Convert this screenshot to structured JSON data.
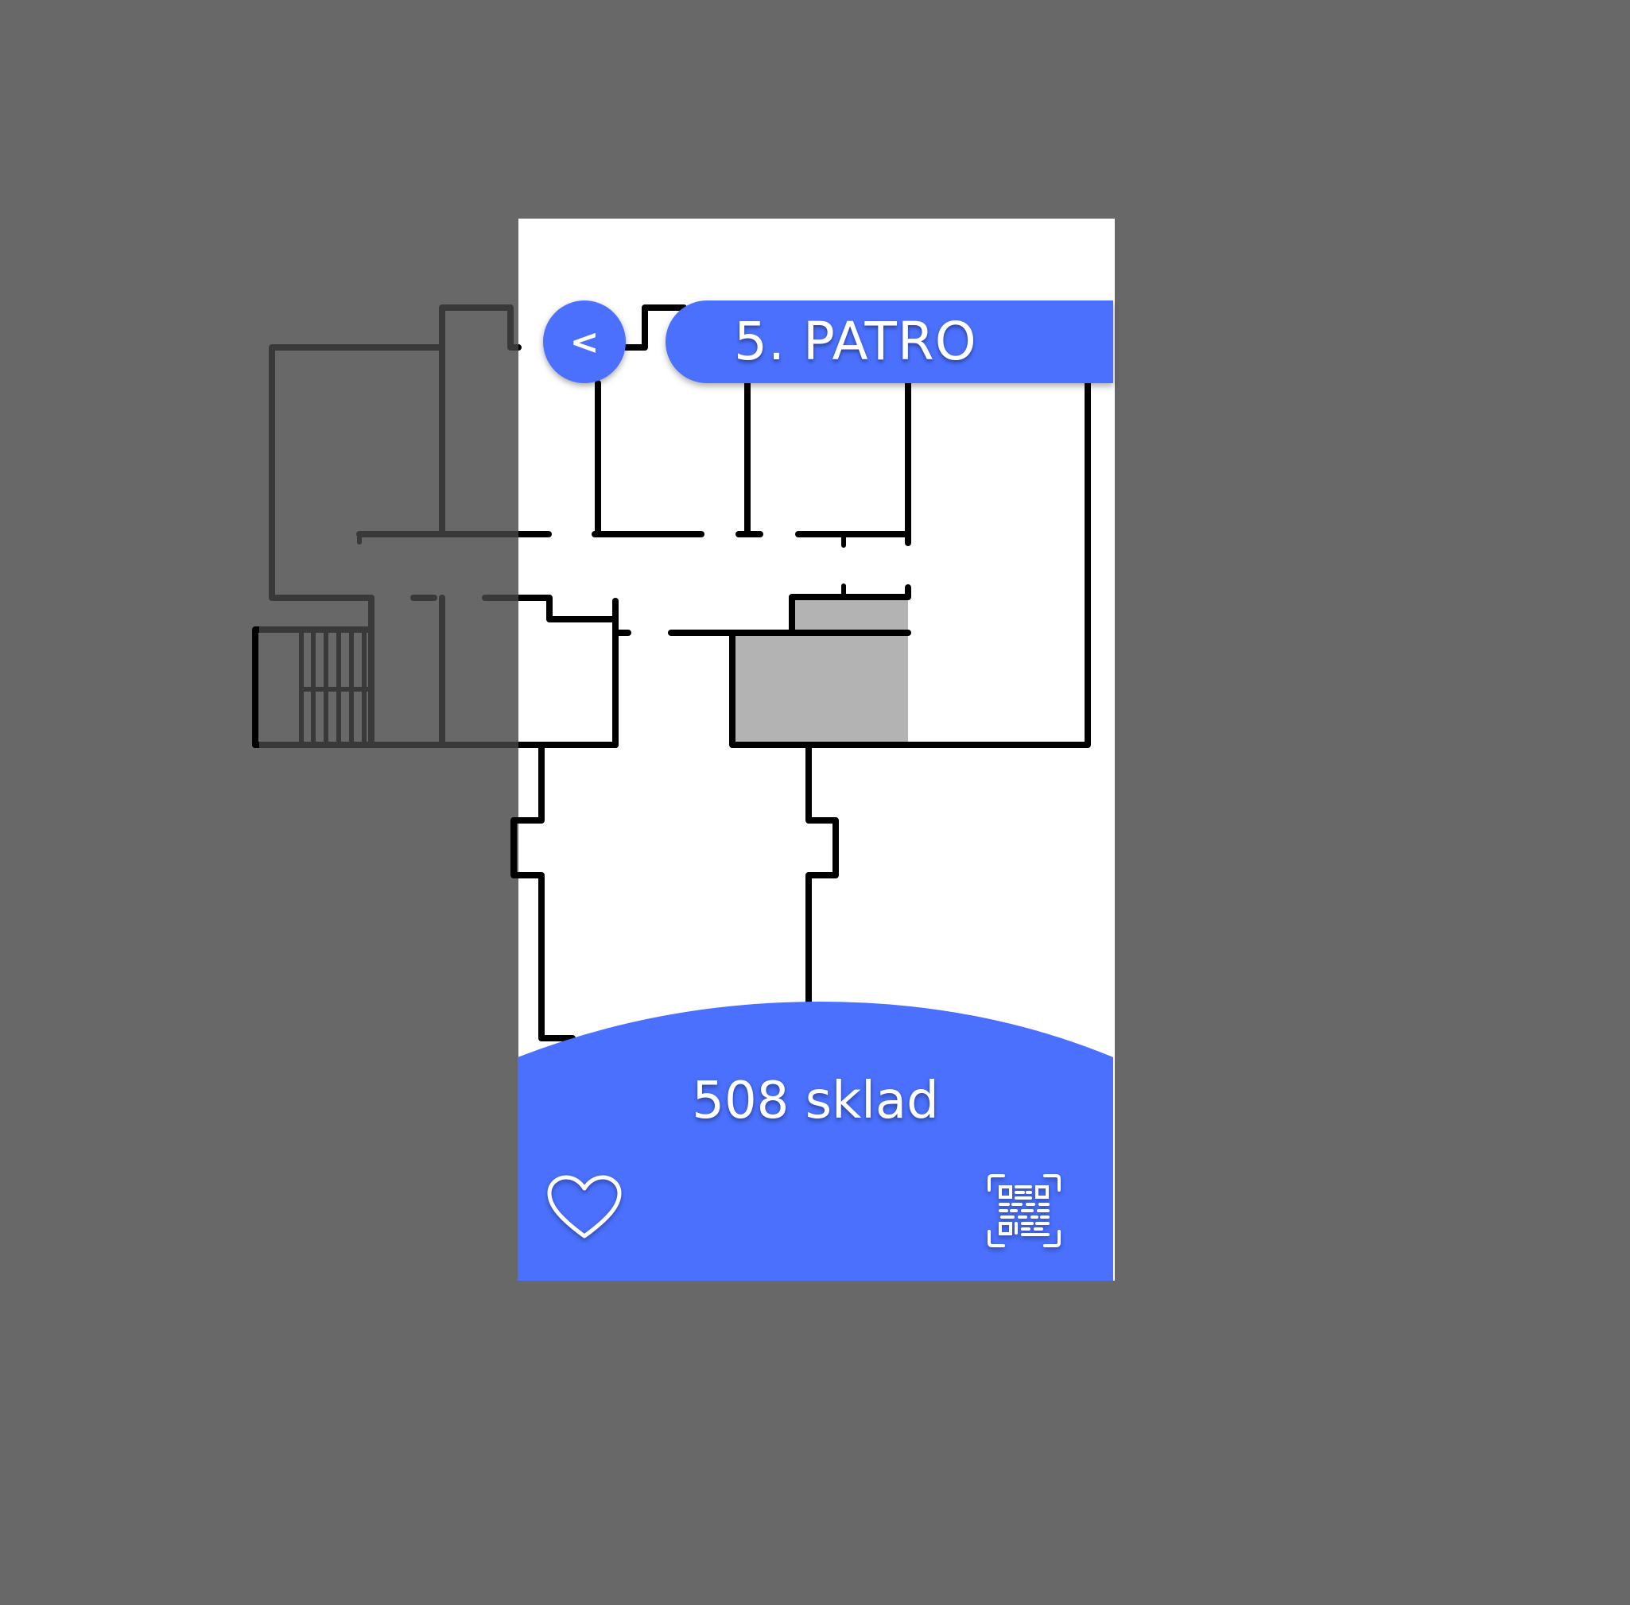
{
  "header": {
    "back_label": "<",
    "floor_title": "5. PATRO"
  },
  "room": {
    "name": "508 sklad"
  },
  "actions": {
    "favorite_icon": "heart-icon",
    "qr_icon": "qr-code-icon"
  },
  "colors": {
    "accent": "#4a70fd",
    "background": "#686868",
    "highlighted_room": "#b3b3b3"
  }
}
